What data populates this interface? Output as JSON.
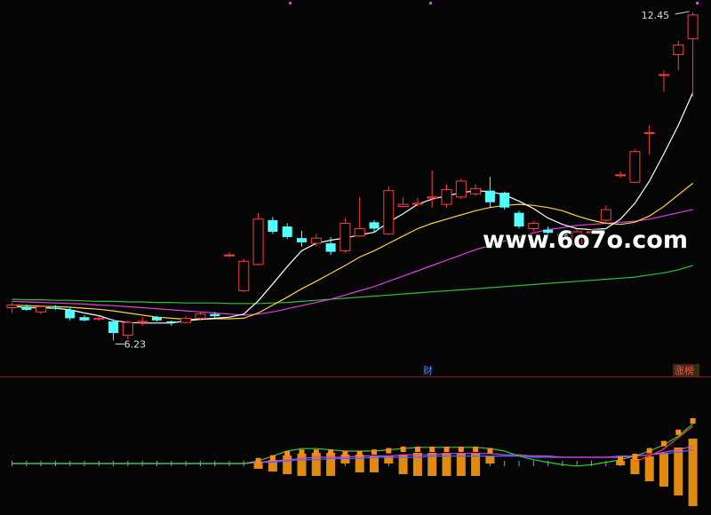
{
  "chart_data": [
    {
      "type": "candlestick",
      "title": "",
      "annotations": {
        "max_label": "12.45",
        "min_label": "6.23"
      },
      "colors": {
        "up": "#ff3b3b",
        "down": "#54ffff",
        "ma5": "#ffffff",
        "ma10": "#ffd23a",
        "ma20": "#e040e0",
        "ma60": "#30c030"
      },
      "candles": [
        {
          "o": 6.9,
          "h": 7.0,
          "l": 6.8,
          "c": 6.95
        },
        {
          "o": 6.92,
          "h": 6.96,
          "l": 6.84,
          "c": 6.86
        },
        {
          "o": 6.82,
          "h": 6.94,
          "l": 6.78,
          "c": 6.92
        },
        {
          "o": 6.9,
          "h": 6.95,
          "l": 6.86,
          "c": 6.88
        },
        {
          "o": 6.86,
          "h": 6.9,
          "l": 6.66,
          "c": 6.7
        },
        {
          "o": 6.72,
          "h": 6.76,
          "l": 6.64,
          "c": 6.66
        },
        {
          "o": 6.68,
          "h": 6.74,
          "l": 6.66,
          "c": 6.7
        },
        {
          "o": 6.64,
          "h": 6.68,
          "l": 6.28,
          "c": 6.42
        },
        {
          "o": 6.38,
          "h": 6.66,
          "l": 6.3,
          "c": 6.62
        },
        {
          "o": 6.62,
          "h": 6.72,
          "l": 6.56,
          "c": 6.64
        },
        {
          "o": 6.72,
          "h": 6.74,
          "l": 6.64,
          "c": 6.66
        },
        {
          "o": 6.64,
          "h": 6.66,
          "l": 6.56,
          "c": 6.62
        },
        {
          "o": 6.62,
          "h": 6.74,
          "l": 6.6,
          "c": 6.7
        },
        {
          "o": 6.7,
          "h": 6.82,
          "l": 6.66,
          "c": 6.78
        },
        {
          "o": 6.78,
          "h": 6.82,
          "l": 6.7,
          "c": 6.74
        },
        {
          "o": 7.9,
          "h": 7.95,
          "l": 7.86,
          "c": 7.9
        },
        {
          "o": 7.22,
          "h": 7.82,
          "l": 7.2,
          "c": 7.78
        },
        {
          "o": 7.72,
          "h": 8.7,
          "l": 7.7,
          "c": 8.58
        },
        {
          "o": 8.56,
          "h": 8.62,
          "l": 8.3,
          "c": 8.34
        },
        {
          "o": 8.44,
          "h": 8.5,
          "l": 8.2,
          "c": 8.24
        },
        {
          "o": 8.22,
          "h": 8.36,
          "l": 8.06,
          "c": 8.14
        },
        {
          "o": 8.12,
          "h": 8.3,
          "l": 8.06,
          "c": 8.22
        },
        {
          "o": 8.12,
          "h": 8.24,
          "l": 7.9,
          "c": 7.96
        },
        {
          "o": 7.98,
          "h": 8.6,
          "l": 7.94,
          "c": 8.5
        },
        {
          "o": 8.26,
          "h": 9.0,
          "l": 8.24,
          "c": 8.4
        },
        {
          "o": 8.52,
          "h": 8.56,
          "l": 8.34,
          "c": 8.4
        },
        {
          "o": 8.3,
          "h": 9.2,
          "l": 8.28,
          "c": 9.12
        },
        {
          "o": 8.82,
          "h": 9.0,
          "l": 8.8,
          "c": 8.86
        },
        {
          "o": 8.86,
          "h": 8.98,
          "l": 8.82,
          "c": 8.88
        },
        {
          "o": 8.98,
          "h": 9.5,
          "l": 8.8,
          "c": 9.0
        },
        {
          "o": 8.86,
          "h": 9.24,
          "l": 8.8,
          "c": 9.14
        },
        {
          "o": 9.0,
          "h": 9.34,
          "l": 8.96,
          "c": 9.3
        },
        {
          "o": 9.06,
          "h": 9.24,
          "l": 9.02,
          "c": 9.16
        },
        {
          "o": 9.12,
          "h": 9.38,
          "l": 8.8,
          "c": 8.9
        },
        {
          "o": 9.08,
          "h": 9.1,
          "l": 8.76,
          "c": 8.8
        },
        {
          "o": 8.7,
          "h": 8.74,
          "l": 8.4,
          "c": 8.44
        },
        {
          "o": 8.4,
          "h": 8.54,
          "l": 8.34,
          "c": 8.5
        },
        {
          "o": 8.38,
          "h": 8.44,
          "l": 8.26,
          "c": 8.32
        },
        {
          "o": 8.3,
          "h": 8.34,
          "l": 8.12,
          "c": 8.2
        },
        {
          "o": 8.1,
          "h": 8.38,
          "l": 8.08,
          "c": 8.34
        },
        {
          "o": 8.34,
          "h": 8.36,
          "l": 8.3,
          "c": 8.34
        },
        {
          "o": 8.56,
          "h": 8.84,
          "l": 8.5,
          "c": 8.76
        },
        {
          "o": 9.42,
          "h": 9.48,
          "l": 9.36,
          "c": 9.42
        },
        {
          "o": 9.28,
          "h": 9.9,
          "l": 9.26,
          "c": 9.86
        },
        {
          "o": 10.22,
          "h": 10.36,
          "l": 9.8,
          "c": 10.22
        },
        {
          "o": 11.32,
          "h": 11.4,
          "l": 11.0,
          "c": 11.32
        },
        {
          "o": 11.7,
          "h": 11.96,
          "l": 11.4,
          "c": 11.88
        },
        {
          "o": 12.0,
          "h": 12.5,
          "l": 10.9,
          "c": 12.45
        }
      ],
      "ma5": [
        6.93,
        6.9,
        6.9,
        6.89,
        6.86,
        6.8,
        6.75,
        6.66,
        6.62,
        6.61,
        6.61,
        6.61,
        6.65,
        6.68,
        6.7,
        6.72,
        6.78,
        7.03,
        7.35,
        7.68,
        7.98,
        8.12,
        8.18,
        8.22,
        8.28,
        8.33,
        8.52,
        8.68,
        8.86,
        8.96,
        9.02,
        9.08,
        9.12,
        9.1,
        9.04,
        8.92,
        8.78,
        8.6,
        8.48,
        8.4,
        8.38,
        8.4,
        8.58,
        8.88,
        9.3,
        9.82,
        10.36,
        10.98
      ],
      "ma10": [
        6.95,
        6.94,
        6.93,
        6.92,
        6.91,
        6.89,
        6.87,
        6.84,
        6.8,
        6.76,
        6.72,
        6.7,
        6.68,
        6.68,
        6.69,
        6.69,
        6.7,
        6.8,
        6.95,
        7.1,
        7.26,
        7.4,
        7.55,
        7.7,
        7.86,
        7.98,
        8.12,
        8.26,
        8.4,
        8.5,
        8.58,
        8.66,
        8.74,
        8.8,
        8.84,
        8.86,
        8.84,
        8.8,
        8.74,
        8.64,
        8.56,
        8.5,
        8.48,
        8.52,
        8.64,
        8.82,
        9.04,
        9.26
      ],
      "ma20": [
        7.02,
        7.01,
        7.0,
        6.99,
        6.98,
        6.97,
        6.95,
        6.94,
        6.92,
        6.9,
        6.88,
        6.86,
        6.84,
        6.82,
        6.8,
        6.78,
        6.76,
        6.78,
        6.82,
        6.88,
        6.94,
        7.0,
        7.06,
        7.14,
        7.22,
        7.3,
        7.4,
        7.5,
        7.6,
        7.7,
        7.8,
        7.9,
        8.0,
        8.08,
        8.16,
        8.24,
        8.32,
        8.38,
        8.42,
        8.46,
        8.48,
        8.5,
        8.52,
        8.54,
        8.58,
        8.64,
        8.7,
        8.76
      ],
      "ma60": [
        7.06,
        7.05,
        7.05,
        7.04,
        7.04,
        7.03,
        7.02,
        7.02,
        7.01,
        7.01,
        7.0,
        7.0,
        6.99,
        6.99,
        6.99,
        6.98,
        6.98,
        6.98,
        6.99,
        7.0,
        7.02,
        7.04,
        7.06,
        7.08,
        7.1,
        7.12,
        7.14,
        7.16,
        7.18,
        7.2,
        7.22,
        7.24,
        7.26,
        7.28,
        7.3,
        7.32,
        7.34,
        7.36,
        7.38,
        7.4,
        7.42,
        7.44,
        7.46,
        7.48,
        7.52,
        7.56,
        7.62,
        7.7
      ],
      "ylim": [
        6.0,
        12.6
      ],
      "markers": {
        "cai": "财",
        "zhangbang": "涨榜"
      }
    },
    {
      "type": "bar",
      "title": "",
      "colors": {
        "bar": "#e08a10",
        "line_green": "#30d030",
        "line_blue": "#4a6aff",
        "line_magenta": "#e040e0",
        "line_red": "#ff4040",
        "marker": "#ff8c1a"
      },
      "up_bars": [
        0,
        0,
        0,
        0,
        0,
        0,
        0,
        0,
        0,
        0,
        0,
        0,
        0,
        0,
        0,
        0,
        0,
        2,
        4,
        9,
        11,
        12,
        12,
        10,
        10,
        8,
        9,
        10,
        12,
        12,
        12,
        12,
        12,
        9,
        0,
        0,
        0,
        0,
        0,
        0,
        0,
        0,
        3,
        5,
        8,
        12,
        18,
        28
      ],
      "down_bars": [
        0,
        0,
        0,
        0,
        0,
        0,
        0,
        0,
        0,
        0,
        0,
        0,
        0,
        0,
        0,
        0,
        0,
        6,
        9,
        12,
        14,
        14,
        14,
        0,
        10,
        10,
        0,
        12,
        14,
        14,
        14,
        14,
        14,
        0,
        0,
        0,
        0,
        0,
        0,
        0,
        0,
        0,
        2,
        12,
        20,
        26,
        36,
        48
      ],
      "markers": [
        0,
        0,
        0,
        0,
        0,
        0,
        0,
        0,
        0,
        0,
        0,
        0,
        0,
        0,
        0,
        0,
        0,
        2,
        4,
        7,
        8,
        8,
        8,
        7,
        7,
        8,
        9,
        10,
        10,
        10,
        10,
        10,
        10,
        9,
        0,
        0,
        0,
        0,
        0,
        0,
        0,
        0,
        3,
        5,
        9,
        14,
        22,
        30
      ],
      "line_green": [
        0,
        0,
        0,
        0,
        0,
        0,
        0,
        0,
        0,
        0,
        0,
        0,
        0,
        0,
        0,
        0,
        0,
        2,
        6,
        10,
        12,
        12,
        11,
        10,
        10,
        10,
        11,
        12,
        13,
        13,
        13,
        13,
        13,
        12,
        10,
        6,
        3,
        1,
        -1,
        -2,
        -1,
        1,
        3,
        6,
        10,
        15,
        22,
        32
      ],
      "line_blue": [
        0,
        0,
        0,
        0,
        0,
        0,
        0,
        0,
        0,
        0,
        0,
        0,
        0,
        0,
        0,
        0,
        0,
        1,
        1,
        2,
        3,
        3,
        4,
        4,
        4,
        5,
        5,
        5,
        5,
        6,
        6,
        6,
        6,
        6,
        6,
        6,
        5,
        5,
        5,
        5,
        5,
        5,
        6,
        6,
        7,
        8,
        9,
        11
      ],
      "line_magenta": [
        0,
        0,
        0,
        0,
        0,
        0,
        0,
        0,
        0,
        0,
        0,
        0,
        0,
        0,
        0,
        0,
        0,
        1,
        2,
        3,
        4,
        5,
        5,
        5,
        6,
        6,
        6,
        7,
        7,
        7,
        8,
        8,
        8,
        8,
        7,
        7,
        6,
        6,
        5,
        5,
        5,
        5,
        5,
        6,
        7,
        9,
        11,
        14
      ],
      "ylim": [
        -50,
        50
      ]
    }
  ],
  "watermark": "www.6o7o.com"
}
